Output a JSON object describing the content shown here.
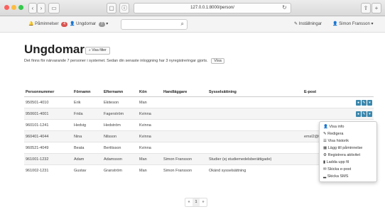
{
  "browser": {
    "url": "127.0.0.1:8000/person/"
  },
  "topbar": {
    "notifications": "Påminnelser",
    "notif_count": "4",
    "section": "Ungdomar",
    "section_count": "7",
    "settings": "Inställningar",
    "user": "Simon Fransson"
  },
  "page": {
    "title": "Ungdomar",
    "filter_btn": "Visa filter",
    "info": "Det finns för närvarande 7 personer i systemet. Sedan din senaste inloggning har 3 nyregistreringar gjorts.",
    "info_btn": "Visa"
  },
  "table": {
    "headers": [
      "Personnummer",
      "Förnamn",
      "Efternamn",
      "Kön",
      "Handläggare",
      "Sysselsättning",
      "E-post"
    ],
    "rows": [
      [
        "950501-4010",
        "Erik",
        "Ekiteson",
        "Man",
        "",
        "",
        ""
      ],
      [
        "950601-4001",
        "Frida",
        "Fagerström",
        "Kvinna",
        "",
        "",
        ""
      ],
      [
        "960101-1241",
        "Hedvig",
        "Hedström",
        "Kvinna",
        "",
        "",
        ""
      ],
      [
        "960401-4044",
        "Nina",
        "Nilsson",
        "Kvinna",
        "",
        "",
        "emsl2@test"
      ],
      [
        "960521-4049",
        "Beata",
        "Berttisson",
        "Kvinna",
        "",
        "",
        ""
      ],
      [
        "961001-1232",
        "Adam",
        "Adamsson",
        "Man",
        "Simon Fransson",
        "Studier (ej studiemedelsberättigade)",
        ""
      ],
      [
        "961002-1231",
        "Gustav",
        "Granström",
        "Man",
        "Simon Fransson",
        "Okänd sysselsättning",
        ""
      ]
    ]
  },
  "menu": {
    "items": [
      "Visa info",
      "Redigera",
      "Visa historik",
      "Lägg till påminnelse",
      "Registrera aktivitet",
      "Ladda upp fil",
      "Skicka e-post",
      "Skicka SMS"
    ]
  },
  "pager": {
    "prev": "«",
    "page": "1",
    "next": "»"
  }
}
